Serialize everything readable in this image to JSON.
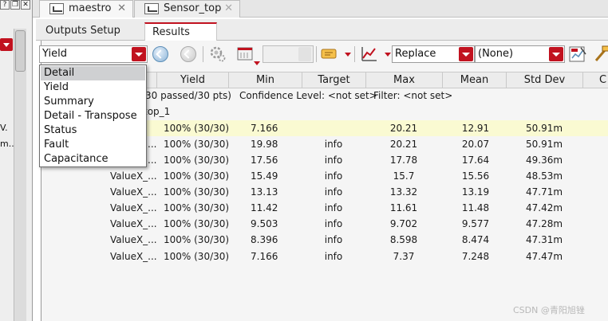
{
  "left_panel": {
    "buttons": [
      "?",
      "❐",
      "✕"
    ],
    "texts": [
      "V.",
      "m.."
    ]
  },
  "tabs": [
    {
      "label": "maestro",
      "close": "✕"
    },
    {
      "label": "Sensor_top",
      "close": "✕"
    }
  ],
  "subtabs": [
    {
      "label": "Outputs Setup"
    },
    {
      "label": "Results"
    }
  ],
  "toolbar": {
    "view_select": "Yield",
    "mode_select": "Replace",
    "filter_select": "(None)"
  },
  "table": {
    "headers": [
      "Yield",
      "Min",
      "Target",
      "Max",
      "Mean",
      "Std Dev",
      "C"
    ],
    "summary": {
      "passed": "30 passed/30 pts)",
      "confidence": "Confidence Level: <not set>",
      "filter": "Filter: <not set>"
    },
    "group_label": "top_1",
    "rows": [
      {
        "name": "",
        "yield": "100% (30/30)",
        "min": "7.166",
        "target": "",
        "max": "20.21",
        "mean": "12.91",
        "std": "50.91m"
      },
      {
        "name": "...",
        "yield": "100% (30/30)",
        "min": "19.98",
        "target": "info",
        "max": "20.21",
        "mean": "20.07",
        "std": "50.91m"
      },
      {
        "name": "...",
        "yield": "100% (30/30)",
        "min": "17.56",
        "target": "info",
        "max": "17.78",
        "mean": "17.64",
        "std": "49.36m"
      },
      {
        "name": "ValueX_...",
        "yield": "100% (30/30)",
        "min": "15.49",
        "target": "info",
        "max": "15.7",
        "mean": "15.56",
        "std": "48.53m"
      },
      {
        "name": "ValueX_...",
        "yield": "100% (30/30)",
        "min": "13.13",
        "target": "info",
        "max": "13.32",
        "mean": "13.19",
        "std": "47.71m"
      },
      {
        "name": "ValueX_...",
        "yield": "100% (30/30)",
        "min": "11.42",
        "target": "info",
        "max": "11.61",
        "mean": "11.48",
        "std": "47.42m"
      },
      {
        "name": "ValueX_...",
        "yield": "100% (30/30)",
        "min": "9.503",
        "target": "info",
        "max": "9.702",
        "mean": "9.577",
        "std": "47.28m"
      },
      {
        "name": "ValueX_...",
        "yield": "100% (30/30)",
        "min": "8.396",
        "target": "info",
        "max": "8.598",
        "mean": "8.474",
        "std": "47.31m"
      },
      {
        "name": "ValueX_...",
        "yield": "100% (30/30)",
        "min": "7.166",
        "target": "info",
        "max": "7.37",
        "mean": "7.248",
        "std": "47.47m"
      }
    ]
  },
  "dropdown": {
    "items": [
      "Detail",
      "Yield",
      "Summary",
      "Detail - Transpose",
      "Status",
      "Fault",
      "Capacitance"
    ],
    "selected": "Detail"
  },
  "watermark": "CSDN @青阳旭锉",
  "colors": {
    "accent_red": "#c1121f",
    "highlight_row": "#fafad2"
  }
}
